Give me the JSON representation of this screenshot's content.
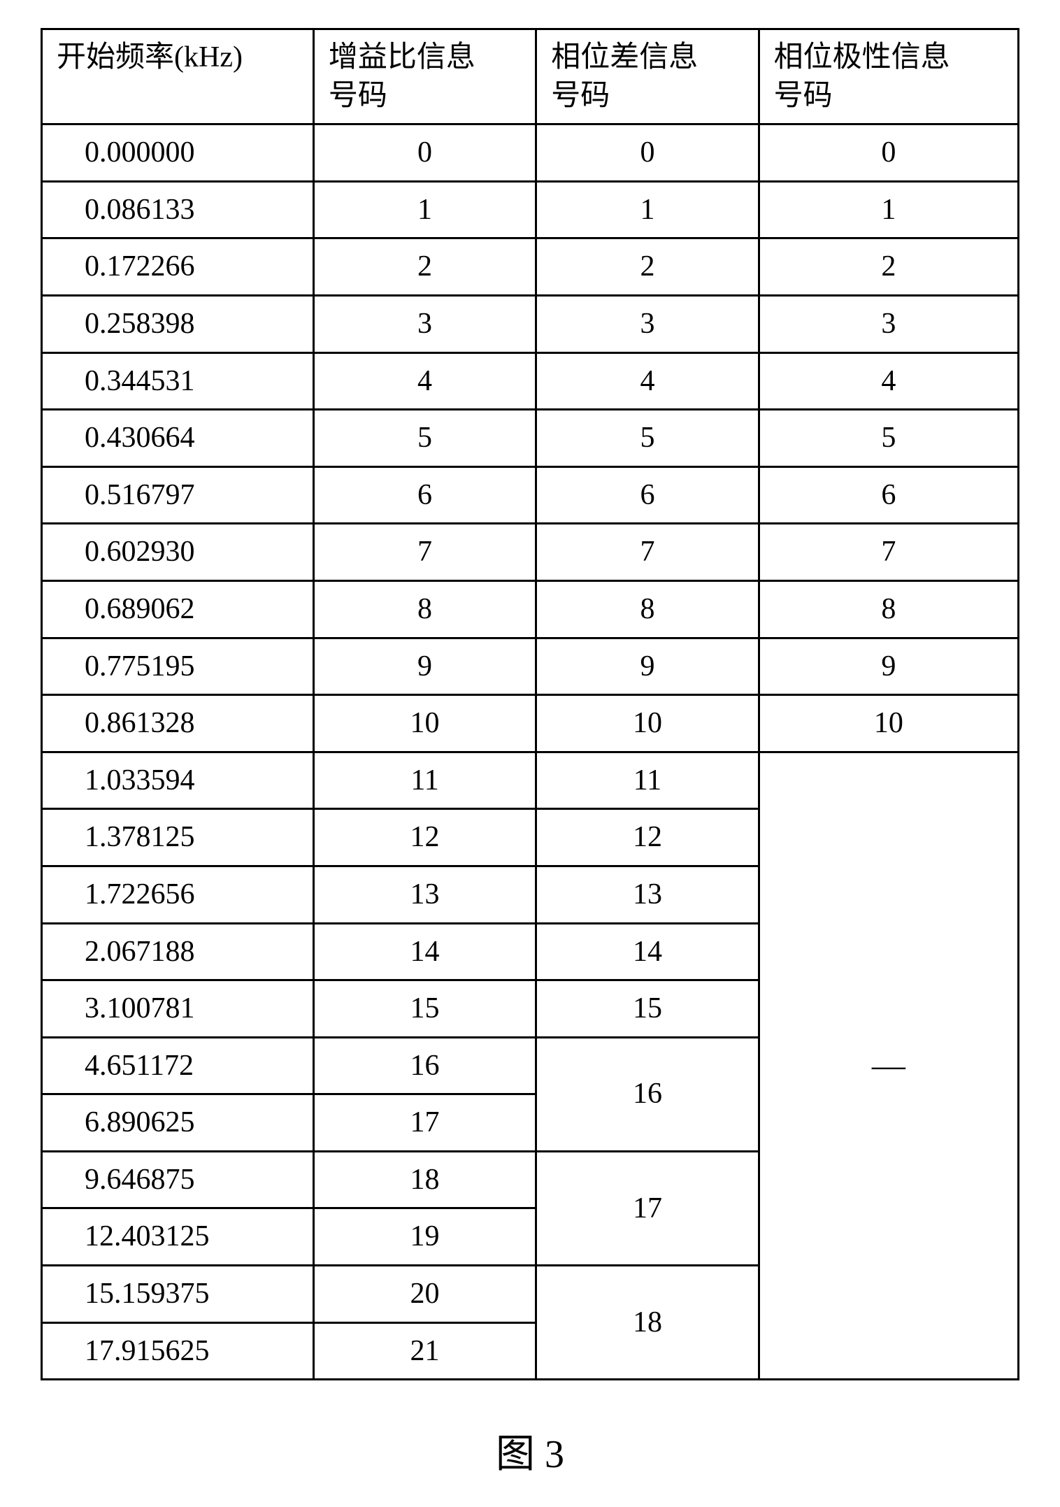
{
  "chart_data": {
    "type": "table",
    "title": "图 3",
    "headers": [
      "开始频率(kHz)",
      "增益比信息号码",
      "相位差信息号码",
      "相位极性信息号码"
    ],
    "rows": [
      {
        "freq": "0.000000",
        "gain": "0",
        "phase_diff": "0",
        "polarity": "0"
      },
      {
        "freq": "0.086133",
        "gain": "1",
        "phase_diff": "1",
        "polarity": "1"
      },
      {
        "freq": "0.172266",
        "gain": "2",
        "phase_diff": "2",
        "polarity": "2"
      },
      {
        "freq": "0.258398",
        "gain": "3",
        "phase_diff": "3",
        "polarity": "3"
      },
      {
        "freq": "0.344531",
        "gain": "4",
        "phase_diff": "4",
        "polarity": "4"
      },
      {
        "freq": "0.430664",
        "gain": "5",
        "phase_diff": "5",
        "polarity": "5"
      },
      {
        "freq": "0.516797",
        "gain": "6",
        "phase_diff": "6",
        "polarity": "6"
      },
      {
        "freq": "0.602930",
        "gain": "7",
        "phase_diff": "7",
        "polarity": "7"
      },
      {
        "freq": "0.689062",
        "gain": "8",
        "phase_diff": "8",
        "polarity": "8"
      },
      {
        "freq": "0.775195",
        "gain": "9",
        "phase_diff": "9",
        "polarity": "9"
      },
      {
        "freq": "0.861328",
        "gain": "10",
        "phase_diff": "10",
        "polarity": "10"
      },
      {
        "freq": "1.033594",
        "gain": "11",
        "phase_diff": "11"
      },
      {
        "freq": "1.378125",
        "gain": "12",
        "phase_diff": "12"
      },
      {
        "freq": "1.722656",
        "gain": "13",
        "phase_diff": "13"
      },
      {
        "freq": "2.067188",
        "gain": "14",
        "phase_diff": "14"
      },
      {
        "freq": "3.100781",
        "gain": "15",
        "phase_diff": "15"
      },
      {
        "freq": "4.651172",
        "gain": "16"
      },
      {
        "freq": "6.890625",
        "gain": "17"
      },
      {
        "freq": "9.646875",
        "gain": "18"
      },
      {
        "freq": "12.403125",
        "gain": "19"
      },
      {
        "freq": "15.159375",
        "gain": "20"
      },
      {
        "freq": "17.915625",
        "gain": "21"
      }
    ],
    "phase_diff_merged": {
      "16": {
        "rowspan": 2,
        "value": "16"
      },
      "18": {
        "rowspan": 2,
        "value": "17"
      },
      "20": {
        "rowspan": 2,
        "value": "18"
      }
    },
    "polarity_dash": "—",
    "polarity_dash_rowspan": 11
  },
  "caption": "图 3"
}
